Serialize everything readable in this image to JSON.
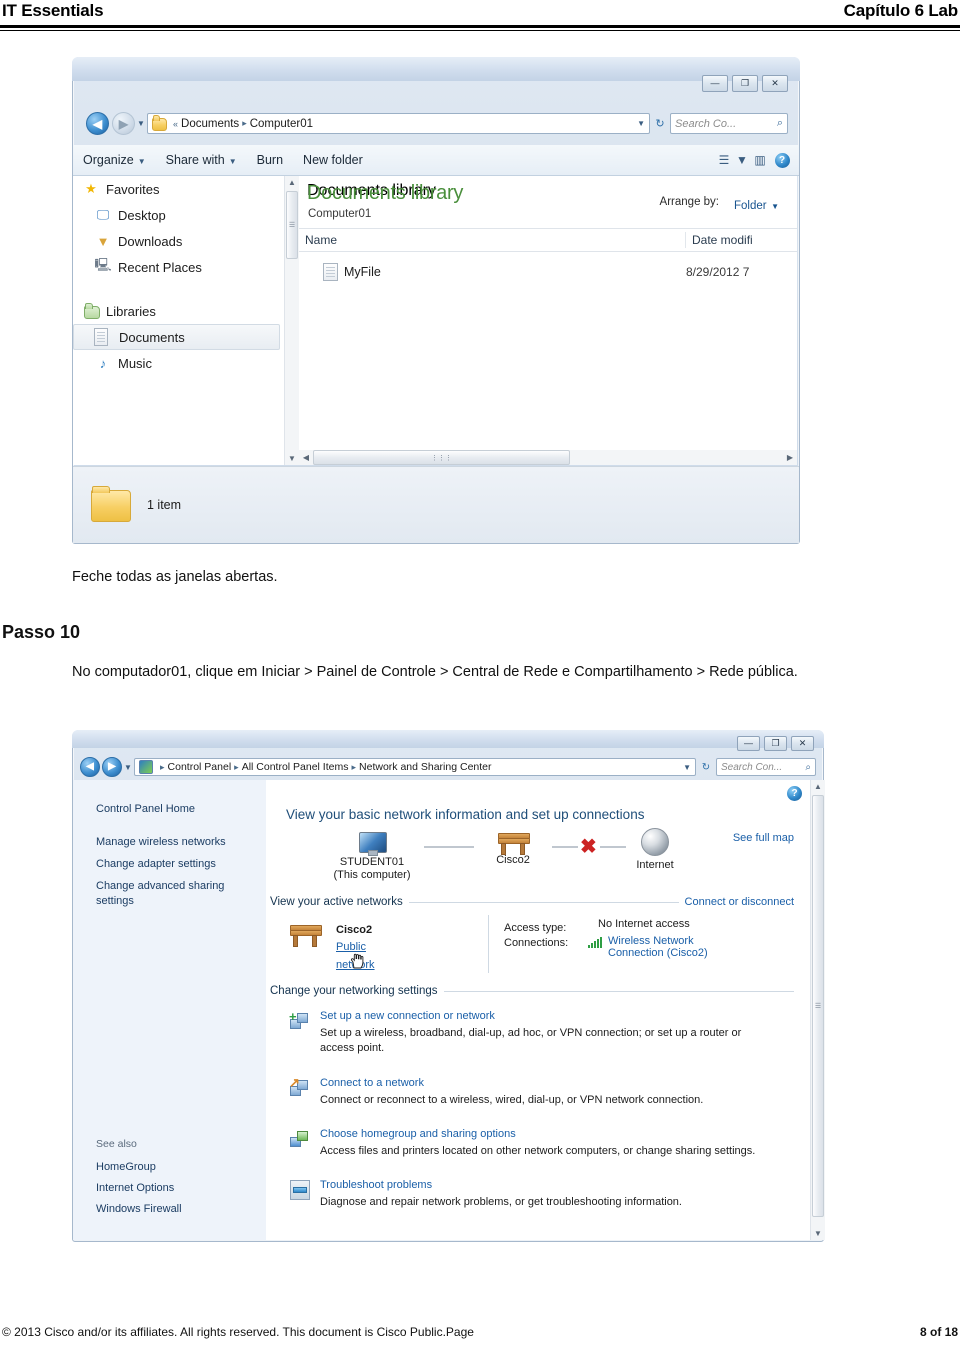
{
  "document": {
    "header_left": "IT Essentials",
    "header_right": "Capítulo 6 Lab",
    "footer_left": "© 2013 Cisco and/or its affiliates. All rights reserved. This document is Cisco Public.Page",
    "footer_right": "8 of 18"
  },
  "body": {
    "intro_paragraph": "Feche todas as janelas abertas.",
    "step_heading": "Passo 10",
    "step_paragraph": "No computador01, clique em Iniciar > Painel de Controle > Central de Rede e Compartilhamento > Rede pública."
  },
  "explorer_window": {
    "window_buttons": {
      "minimize": "—",
      "maximize": "❐",
      "close": "✕"
    },
    "address": {
      "back_glyph": "◀",
      "forward_glyph": "▶",
      "dropdown_glyph": "▼",
      "chevrons": "«",
      "crumb1": "Documents",
      "crumb_sep": "▸",
      "crumb2": "Computer01",
      "caret": "▼",
      "refresh_glyph": "↻",
      "search_placeholder": "Search Co...",
      "search_icon": "⌕"
    },
    "toolbar": {
      "organize": "Organize",
      "share_with": "Share with",
      "burn": "Burn",
      "new_folder": "New folder",
      "caret": "▼",
      "view_icon": "☰",
      "preview_icon": "▥",
      "help_icon": "?"
    },
    "nav_pane": [
      {
        "label": "Favorites",
        "icon": "star-icon",
        "glyph": "★",
        "indent": false,
        "selected": false
      },
      {
        "label": "Desktop",
        "icon": "desktop-icon",
        "glyph": "🖥",
        "indent": true,
        "selected": false
      },
      {
        "label": "Downloads",
        "icon": "downloads-icon",
        "glyph": "📥",
        "indent": true,
        "selected": false
      },
      {
        "label": "Recent Places",
        "icon": "recent-places-icon",
        "glyph": "🕘",
        "indent": true,
        "selected": false
      },
      {
        "label": "Libraries",
        "icon": "libraries-icon",
        "glyph": "📚",
        "indent": false,
        "selected": false
      },
      {
        "label": "Documents",
        "icon": "documents-icon",
        "glyph": "📄",
        "indent": true,
        "selected": true
      },
      {
        "label": "Music",
        "icon": "music-icon",
        "glyph": "♪",
        "indent": true,
        "selected": false
      }
    ],
    "library": {
      "title": "Documents library",
      "subtitle": "Computer01",
      "arrange_label": "Arrange by:",
      "arrange_value": "Folder",
      "arrange_caret": "▼"
    },
    "columns": [
      "Name",
      "Date modifi"
    ],
    "files": [
      {
        "name": "MyFile",
        "date_modified": "8/29/2012 7"
      }
    ],
    "status_text": "1 item",
    "hscroll": {
      "left_arrow": "◀",
      "right_arrow": "▶",
      "grip": "⋮⋮⋮"
    },
    "vscroll": {
      "up_arrow": "▲",
      "down_arrow": "▼",
      "grip": "☰"
    }
  },
  "network_window": {
    "window_buttons": {
      "minimize": "—",
      "maximize": "❐",
      "close": "✕"
    },
    "address": {
      "back_glyph": "◀",
      "forward_glyph": "▶",
      "dropdown_glyph": "▼",
      "crumb_sep": "▸",
      "crumb1": "Control Panel",
      "crumb2": "All Control Panel Items",
      "crumb3": "Network and Sharing Center",
      "caret": "▼",
      "refresh_glyph": "↻",
      "search_placeholder": "Search Con...",
      "search_icon": "⌕"
    },
    "left_pane": {
      "home": "Control Panel Home",
      "links": [
        "Manage wireless networks",
        "Change adapter settings",
        "Change advanced sharing settings"
      ],
      "see_also_label": "See also",
      "see_also_links": [
        "HomeGroup",
        "Internet Options",
        "Windows Firewall"
      ]
    },
    "main": {
      "heading": "View your basic network information and set up connections",
      "see_full_map": "See full map",
      "map_nodes": [
        {
          "caption_line1": "STUDENT01",
          "caption_line2": "(This computer)",
          "icon": "computer-icon"
        },
        {
          "caption_line1": "Cisco2",
          "caption_line2": "",
          "icon": "bench-network-icon"
        },
        {
          "caption_line1": "Internet",
          "caption_line2": "",
          "icon": "globe-icon"
        }
      ],
      "active_networks_label": "View your active networks",
      "connect_or_disconnect": "Connect or disconnect",
      "active_network": {
        "name": "Cisco2",
        "type_link": "Public network",
        "access_type_label": "Access type:",
        "access_type_value": "No Internet access",
        "connections_label": "Connections:",
        "connections_value_line1": "Wireless Network",
        "connections_value_line2": "Connection (Cisco2)"
      },
      "change_settings_label": "Change your networking settings",
      "settings_items": [
        {
          "title": "Set up a new connection or network",
          "desc_line1": "Set up a wireless, broadband, dial-up, ad hoc, or VPN connection; or set up a router or",
          "desc_line2": "access point.",
          "icon": "new-connection-icon"
        },
        {
          "title": "Connect to a network",
          "desc_line1": "Connect or reconnect to a wireless, wired, dial-up, or VPN network connection.",
          "desc_line2": "",
          "icon": "connect-network-icon"
        },
        {
          "title": "Choose homegroup and sharing options",
          "desc_line1": "Access files and printers located on other network computers, or change sharing settings.",
          "desc_line2": "",
          "icon": "homegroup-icon"
        },
        {
          "title": "Troubleshoot problems",
          "desc_line1": "Diagnose and repair network problems, or get troubleshooting information.",
          "desc_line2": "",
          "icon": "troubleshoot-icon"
        }
      ],
      "help_icon": "?",
      "red_x": "✖"
    },
    "vscroll": {
      "up_arrow": "▲",
      "down_arrow": "▼",
      "grip": "☰"
    }
  },
  "colors": {
    "library_title_green": "#4a8f3c",
    "link_blue": "#1a5fa8",
    "heading_blue": "#1f4e79",
    "error_red": "#cc2222",
    "signal_green": "#2f9e44"
  }
}
